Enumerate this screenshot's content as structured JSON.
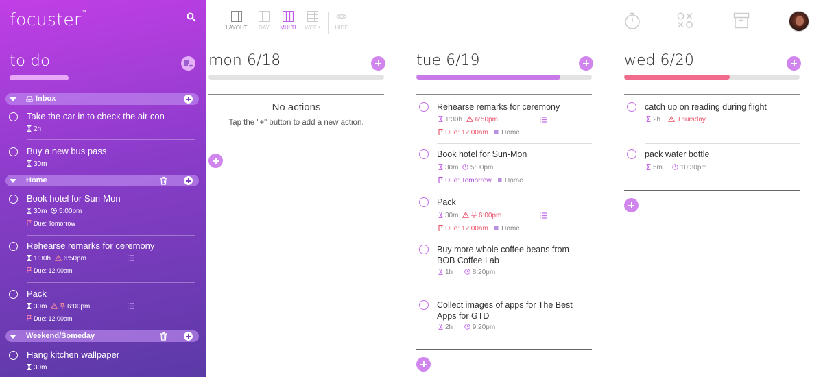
{
  "app": {
    "logo": "focuster",
    "logo_tm": "™"
  },
  "sidebar": {
    "title": "to do",
    "categories": [
      {
        "label": "Inbox"
      },
      {
        "label": "Home"
      },
      {
        "label": "Weekend/Someday"
      }
    ],
    "items": [
      {
        "title": "Take the car in to check the air con",
        "duration": "2h"
      },
      {
        "title": "Buy a new bus pass",
        "duration": "30m"
      },
      {
        "title": "Book hotel for Sun-Mon",
        "duration": "30m",
        "time": "5:00pm",
        "due": "Due: Tomorrow"
      },
      {
        "title": "Rehearse remarks for ceremony",
        "duration": "1:30h",
        "time": "6:50pm",
        "due": "Due: 12:00am"
      },
      {
        "title": "Pack",
        "duration": "30m",
        "time": "6:00pm",
        "due": "Due: 12:00am"
      },
      {
        "title": "Hang kitchen wallpaper",
        "duration": "30m"
      }
    ]
  },
  "toolbar": {
    "layout": "LAYOUT",
    "day": "DAY",
    "multi": "MULTI",
    "week": "WEEK",
    "hide": "HIDE"
  },
  "columns": [
    {
      "title": "mon 6/18",
      "progress": 0,
      "empty_title": "No actions",
      "empty_text": "Tap the \"+\" button to add a new action."
    },
    {
      "title": "tue 6/19",
      "progress": 0.82,
      "tasks": [
        {
          "title": "Rehearse remarks for ceremony",
          "duration": "1:30h",
          "time": "6:50pm",
          "due": "Due: 12:00am",
          "context": "Home"
        },
        {
          "title": "Book hotel for Sun-Mon",
          "duration": "30m",
          "time": "5:00pm",
          "due": "Due: Tomorrow",
          "context": "Home"
        },
        {
          "title": "Pack",
          "duration": "30m",
          "time": "6:00pm",
          "due": "Due: 12:00am",
          "context": "Home"
        },
        {
          "title": "Buy more whole coffee beans from BOB Coffee Lab",
          "duration": "1h",
          "time": "8:20pm"
        },
        {
          "title": "Collect images of apps for The Best Apps for GTD",
          "duration": "2h",
          "time": "9:20pm"
        }
      ]
    },
    {
      "title": "wed 6/20",
      "progress": 0.6,
      "tasks": [
        {
          "title": "catch up on reading during flight",
          "duration": "2h",
          "time": "Thursday"
        },
        {
          "title": "pack water bottle",
          "duration": "5m",
          "time": "10:30pm"
        }
      ]
    }
  ],
  "colors": {
    "accent": "#d186ee",
    "sidebar_top": "#c13fe6",
    "sidebar_bottom": "#5b3aa6",
    "warning": "#e9536a",
    "progress_tue": "#c97ae9",
    "progress_wed": "#f06b8c"
  },
  "icons": [
    "search-icon",
    "add-list-icon",
    "inbox-icon",
    "trash-icon",
    "plus-icon",
    "hourglass-icon",
    "clock-icon",
    "warning-icon",
    "pin-icon",
    "flag-icon",
    "book-icon",
    "list-icon",
    "layout-icon",
    "day-icon",
    "multi-icon",
    "week-icon",
    "eye-icon",
    "timer-icon",
    "tictactoe-icon",
    "archive-icon",
    "avatar"
  ]
}
